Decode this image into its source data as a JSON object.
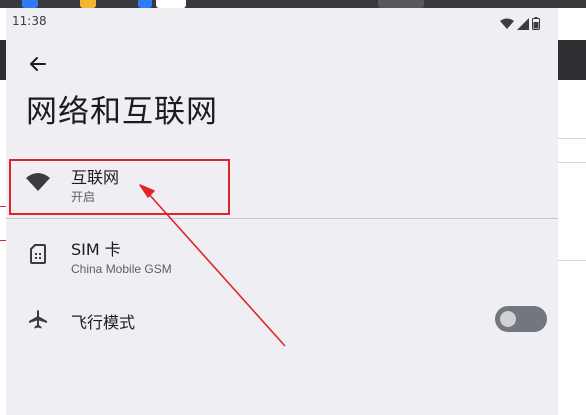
{
  "status_bar": {
    "time": "11:38"
  },
  "header": {
    "title": "网络和互联网"
  },
  "items": [
    {
      "label": "互联网",
      "sub": "开启",
      "icon": "wifi-icon"
    },
    {
      "label": "SIM 卡",
      "sub": "China Mobile GSM",
      "icon": "sim-card-icon"
    },
    {
      "label": "飞行模式",
      "icon": "airplane-icon",
      "toggle": "off"
    }
  ],
  "colors": {
    "annotation": "#e0252a",
    "toggle_off_track": "#73767c"
  }
}
